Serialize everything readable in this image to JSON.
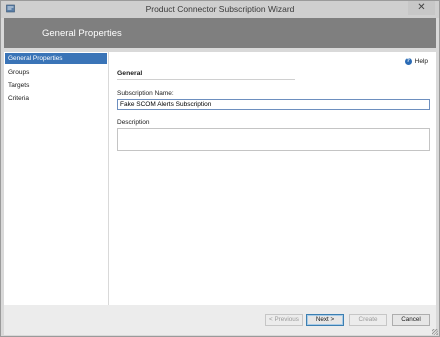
{
  "window": {
    "title": "Product Connector Subscription Wizard",
    "close_glyph": "✕"
  },
  "header": {
    "title": "General Properties"
  },
  "nav": {
    "items": [
      {
        "label": "General Properties",
        "active": true
      },
      {
        "label": "Groups",
        "active": false
      },
      {
        "label": "Targets",
        "active": false
      },
      {
        "label": "Criteria",
        "active": false
      }
    ]
  },
  "content": {
    "help_label": "Help",
    "help_glyph": "?",
    "section_heading": "General",
    "subscription_name_label": "Subscription Name:",
    "subscription_name_value": "Fake SCOM Alerts Subscription",
    "description_label": "Description",
    "description_value": ""
  },
  "footer": {
    "previous_label": "< Previous",
    "next_label": "Next >",
    "create_label": "Create",
    "cancel_label": "Cancel"
  },
  "colors": {
    "header_band": "#7f7f7f",
    "nav_selected": "#3a74b7",
    "window_chrome": "#d9d9d9"
  },
  "icons": [
    "app-icon",
    "close-icon",
    "help-icon",
    "resize-grip-icon"
  ]
}
